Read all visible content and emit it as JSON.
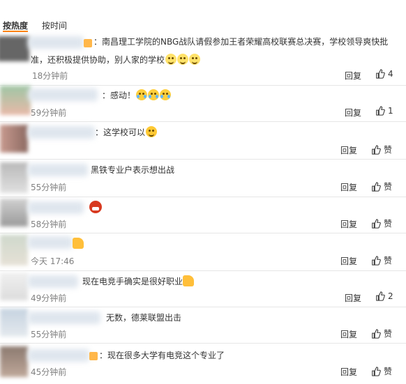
{
  "sort": {
    "hot": "按热度",
    "time": "按时间"
  },
  "colors": {
    "accent": "#ff8200",
    "time": "#808080",
    "divider": "#e6e6e6"
  },
  "comments": [
    {
      "text": "：南昌理工学院的NBG战队请假参加王者荣耀高校联赛总决赛，学校领导爽快批",
      "text2": "准，还积极提供协助，别人家的学校",
      "time": "18分钟前",
      "reply": "回复",
      "like": "4",
      "emojis": [
        "sweat-emoji",
        "sweat-emoji",
        "sweat-emoji"
      ]
    },
    {
      "text": "：感动！",
      "time": "59分钟前",
      "reply": "回复",
      "like": "1",
      "emojis": [
        "cry-emoji",
        "cry-emoji",
        "cry-emoji"
      ]
    },
    {
      "text": "：这学校可以",
      "time": "",
      "reply": "回复",
      "like": "赞",
      "emojis": [
        "laugh-emoji"
      ]
    },
    {
      "text": "黑铁专业户表示想出战",
      "time": "55分钟前",
      "reply": "回复",
      "like": "赞"
    },
    {
      "text": "",
      "time": "58分钟前",
      "reply": "回复",
      "like": "赞",
      "emojis": [
        "red-face-emoji"
      ]
    },
    {
      "text": "",
      "time": "今天 17:46",
      "reply": "回复",
      "like": "赞",
      "emojis": [
        "thumbs-up-emoji"
      ]
    },
    {
      "text": "现在电竞手确实是很好职业",
      "time": "49分钟前",
      "reply": "回复",
      "like": "2",
      "emojis": [
        "thumbs-up-emoji"
      ]
    },
    {
      "text": "无数，德莱联盟出击",
      "time": "55分钟前",
      "reply": "回复",
      "like": "赞"
    },
    {
      "text": "：现在很多大学有电竞这个专业了",
      "time": "45分钟前",
      "reply": "回复",
      "like": "赞"
    }
  ]
}
